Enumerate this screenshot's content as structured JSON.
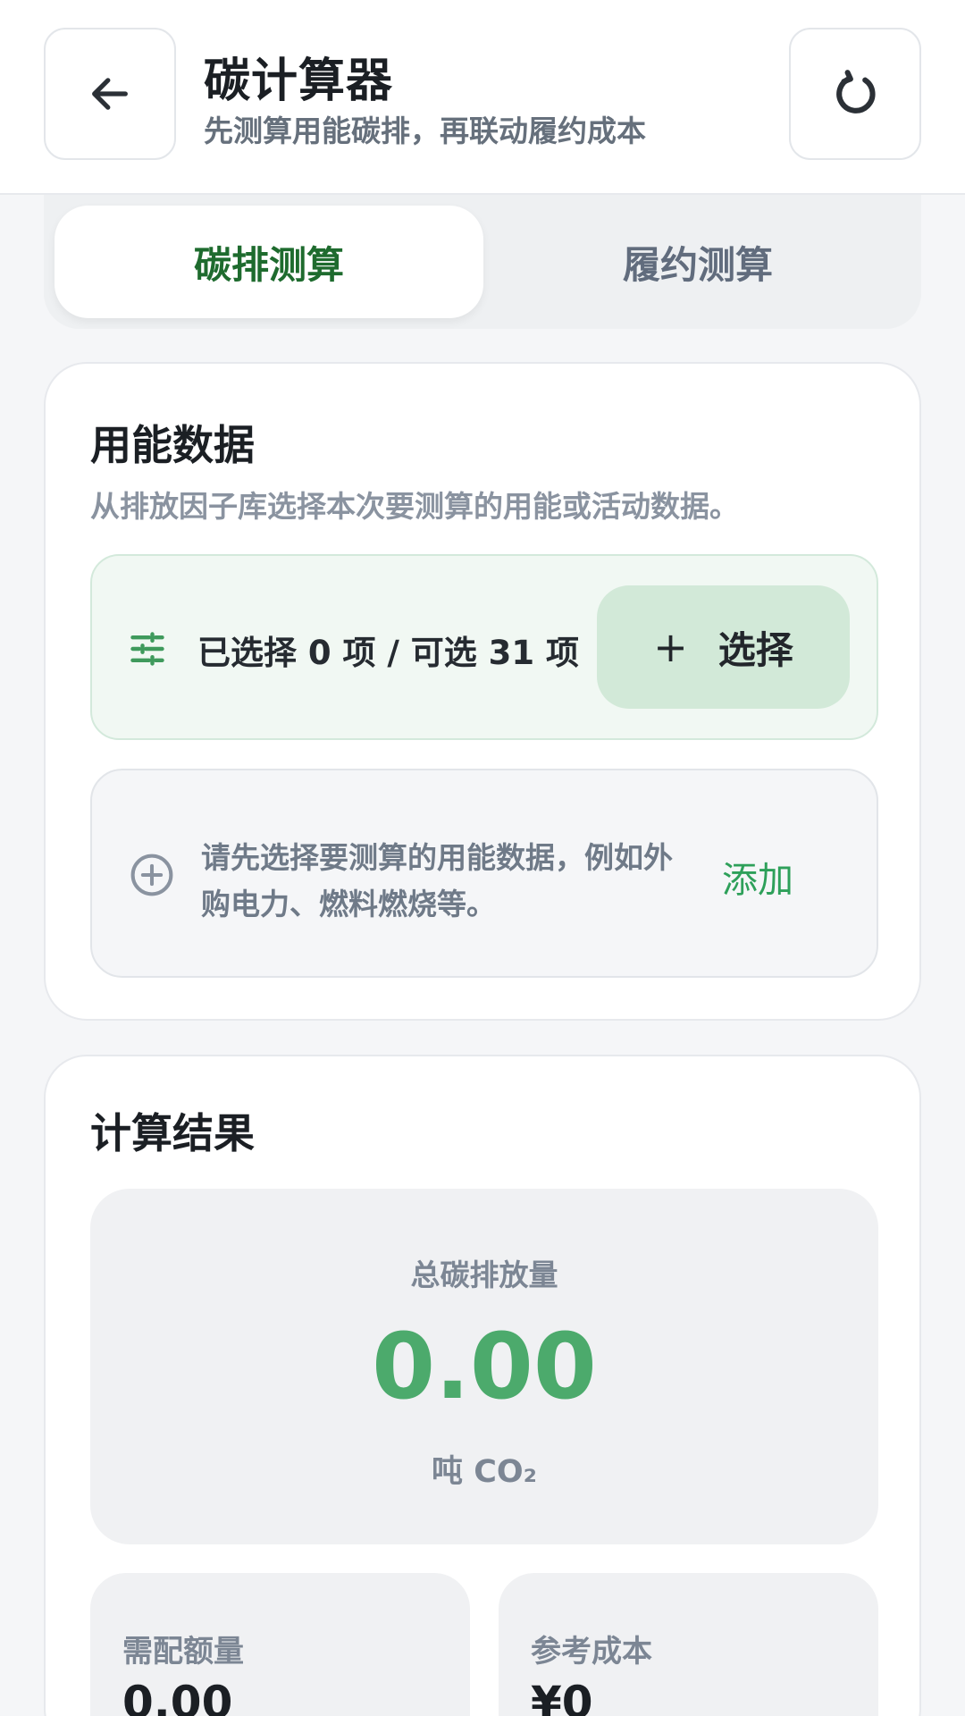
{
  "header": {
    "title": "碳计算器",
    "subtitle": "先测算用能碳排，再联动履约成本",
    "back_icon": "arrow-left-icon",
    "reset_icon": "refresh-icon"
  },
  "tabs": [
    {
      "label": "碳排测算",
      "active": true
    },
    {
      "label": "履约测算",
      "active": false
    }
  ],
  "energy": {
    "title": "用能数据",
    "description": "从排放因子库选择本次要测算的用能或活动数据。",
    "selection_summary": "已选择 0 项 / 可选 31 项",
    "select_button": "选择",
    "select_button_prefix": "+",
    "empty_prompt": "请先选择要测算的用能数据，例如外购电力、燃料燃烧等。",
    "add_link": "添加"
  },
  "result": {
    "title": "计算结果",
    "total_label": "总碳排放量",
    "total_value": "0.00",
    "total_unit": "吨 CO₂",
    "quota_label": "需配额量",
    "quota_value": "0.00",
    "cost_label": "参考成本",
    "cost_value": "¥0"
  },
  "colors": {
    "accent_green": "#4caa6c",
    "tab_active_text": "#1e6b2e",
    "link_green": "#2ea05a",
    "select_button_bg": "#d2e9d8"
  }
}
